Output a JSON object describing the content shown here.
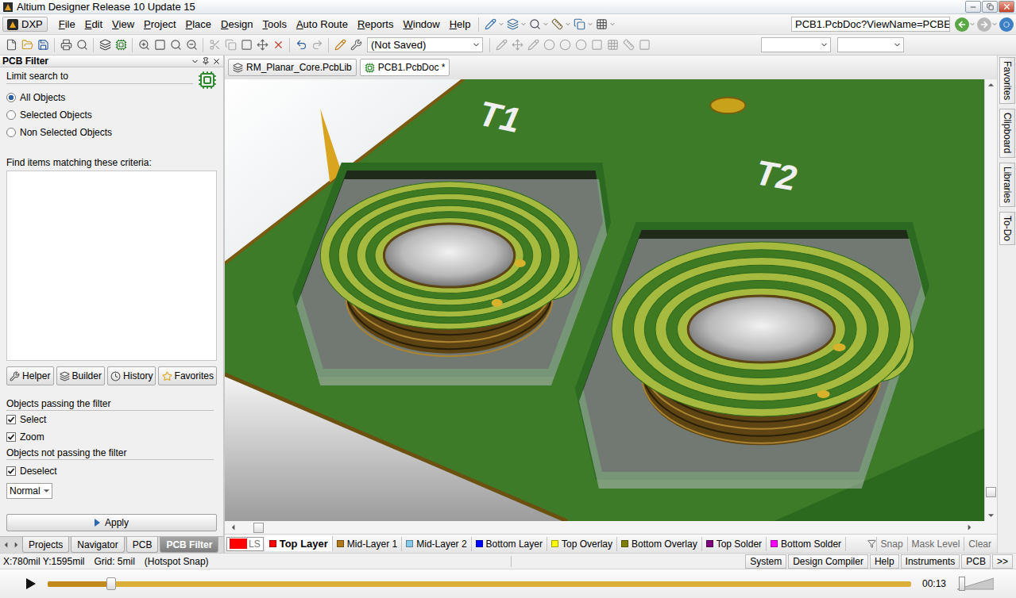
{
  "window": {
    "title": "Altium Designer Release 10 Update 15"
  },
  "menu": {
    "logo": "DXP",
    "items": [
      "File",
      "Edit",
      "View",
      "Project",
      "Place",
      "Design",
      "Tools",
      "Auto Route",
      "Reports",
      "Window",
      "Help"
    ],
    "address": "PCB1.PcbDoc?ViewName=PCBE"
  },
  "toolbar": {
    "status_dropdown": "(Not Saved)"
  },
  "panel": {
    "title": "PCB Filter",
    "limit_label": "Limit search to",
    "scope": [
      {
        "label": "All Objects",
        "selected": true
      },
      {
        "label": "Selected Objects",
        "selected": false
      },
      {
        "label": "Non Selected Objects",
        "selected": false
      }
    ],
    "criteria_label": "Find items matching these criteria:",
    "buttons": [
      "Helper",
      "Builder",
      "History",
      "Favorites"
    ],
    "passing_label": "Objects passing the filter",
    "passing": [
      {
        "label": "Select",
        "checked": true
      },
      {
        "label": "Zoom",
        "checked": true
      }
    ],
    "failing_label": "Objects not passing the filter",
    "failing": [
      {
        "label": "Deselect",
        "checked": true
      }
    ],
    "mode": "Normal",
    "apply": "Apply",
    "tabs": [
      {
        "label": "Projects",
        "selected": false
      },
      {
        "label": "Navigator",
        "selected": false
      },
      {
        "label": "PCB",
        "selected": false
      },
      {
        "label": "PCB Filter",
        "selected": true
      }
    ]
  },
  "documents": [
    {
      "label": "RM_Planar_Core.PcbLib",
      "selected": false
    },
    {
      "label": "PCB1.PcbDoc *",
      "selected": true
    }
  ],
  "view": {
    "designators": [
      {
        "label": "T1"
      },
      {
        "label": "T2"
      }
    ]
  },
  "side_tabs": [
    "Favorites",
    "Clipboard",
    "Libraries",
    "To-Do"
  ],
  "layers": {
    "current": {
      "label": "LS",
      "color": "#ff0000"
    },
    "items": [
      {
        "label": "Top Layer",
        "color": "#ff0000",
        "selected": true
      },
      {
        "label": "Mid-Layer 1",
        "color": "#b07818",
        "selected": false
      },
      {
        "label": "Mid-Layer 2",
        "color": "#86c8e8",
        "selected": false
      },
      {
        "label": "Bottom Layer",
        "color": "#0000ff",
        "selected": false
      },
      {
        "label": "Top Overlay",
        "color": "#ffff00",
        "selected": false
      },
      {
        "label": "Bottom Overlay",
        "color": "#808000",
        "selected": false
      },
      {
        "label": "Top Solder",
        "color": "#800080",
        "selected": false
      },
      {
        "label": "Bottom Solder",
        "color": "#ff00ff",
        "selected": false
      }
    ],
    "actions": [
      "Snap",
      "Mask Level",
      "Clear"
    ]
  },
  "status_bar": {
    "coords": "X:780mil Y:1595mil",
    "grid": "Grid: 5mil",
    "snap": "(Hotspot Snap)",
    "buttons": [
      "System",
      "Design Compiler",
      "Help",
      "Instruments",
      "PCB"
    ],
    "more": ">>"
  },
  "player": {
    "time": "00:13",
    "level": 0.074,
    "volume": 0.05
  }
}
